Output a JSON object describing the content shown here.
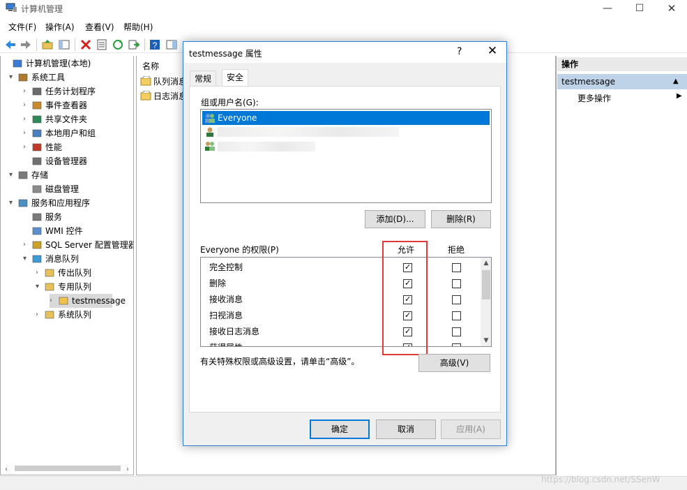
{
  "window": {
    "title": "计算机管理",
    "min_glyph": "—",
    "max_glyph": "☐",
    "close_glyph": "✕"
  },
  "menu": [
    {
      "label": "文件(F)"
    },
    {
      "label": "操作(A)"
    },
    {
      "label": "查看(V)"
    },
    {
      "label": "帮助(H)"
    }
  ],
  "tree": {
    "items": [
      {
        "label": "计算机管理(本地)",
        "expander": "",
        "icon": "computer-icon"
      },
      {
        "label": "系统工具",
        "expander": "▾",
        "icon": "tools-icon"
      },
      {
        "label": "任务计划程序",
        "expander": "›",
        "icon": "clock-icon"
      },
      {
        "label": "事件查看器",
        "expander": "›",
        "icon": "event-viewer-icon"
      },
      {
        "label": "共享文件夹",
        "expander": "›",
        "icon": "shared-folder-icon"
      },
      {
        "label": "本地用户和组",
        "expander": "›",
        "icon": "users-icon"
      },
      {
        "label": "性能",
        "expander": "›",
        "icon": "performance-icon"
      },
      {
        "label": "设备管理器",
        "expander": "",
        "icon": "device-manager-icon"
      },
      {
        "label": "存储",
        "expander": "▾",
        "icon": "storage-icon"
      },
      {
        "label": "磁盘管理",
        "expander": "",
        "icon": "disk-icon"
      },
      {
        "label": "服务和应用程序",
        "expander": "▾",
        "icon": "services-apps-icon"
      },
      {
        "label": "服务",
        "expander": "",
        "icon": "gear-icon"
      },
      {
        "label": "WMI 控件",
        "expander": "",
        "icon": "wmi-icon"
      },
      {
        "label": "SQL Server 配置管理器",
        "expander": "›",
        "icon": "sql-server-icon"
      },
      {
        "label": "消息队列",
        "expander": "▾",
        "icon": "message-queue-icon"
      },
      {
        "label": "传出队列",
        "expander": "›",
        "icon": "folder-icon"
      },
      {
        "label": "专用队列",
        "expander": "▾",
        "icon": "folder-icon"
      },
      {
        "label": "testmessage",
        "expander": "›",
        "icon": "queue-folder-icon"
      },
      {
        "label": "系统队列",
        "expander": "›",
        "icon": "folder-icon"
      }
    ]
  },
  "list": {
    "column_name": "名称",
    "rows": [
      {
        "label": "队列消息"
      },
      {
        "label": "日志消息"
      }
    ]
  },
  "actions": {
    "header": "操作",
    "section": "testmessage",
    "more": "更多操作",
    "collapse_glyph": "▲",
    "more_arrow": "▶"
  },
  "dialog": {
    "title": "testmessage 属性",
    "help": "?",
    "close": "✕",
    "tabs": [
      {
        "label": "常规",
        "active": false
      },
      {
        "label": "安全",
        "active": true
      }
    ],
    "group_label": "组或用户名(G):",
    "users": [
      {
        "name": "Everyone",
        "selected": true
      },
      {
        "name": "",
        "selected": false
      },
      {
        "name": "",
        "selected": false
      }
    ],
    "add_button": "添加(D)...",
    "remove_button": "删除(R)",
    "perm_label": "Everyone 的权限(P)",
    "allow_header": "允许",
    "deny_header": "拒绝",
    "permissions": [
      {
        "name": "完全控制",
        "allow": true,
        "deny": false
      },
      {
        "name": "删除",
        "allow": true,
        "deny": false
      },
      {
        "name": "接收消息",
        "allow": true,
        "deny": false
      },
      {
        "name": "扫视消息",
        "allow": true,
        "deny": false
      },
      {
        "name": "接收日志消息",
        "allow": true,
        "deny": false
      },
      {
        "name": "获得属性",
        "allow": true,
        "deny": false
      }
    ],
    "advanced_text": "有关特殊权限或高级设置，请单击“高级”。",
    "advanced_button": "高级(V)",
    "ok_button": "确定",
    "cancel_button": "取消",
    "apply_button": "应用(A)"
  },
  "watermark": "https://blog.csdn.net/SSenW",
  "colors": {
    "selection": "#0078d7",
    "highlight_box": "#e23a3a",
    "action_section_bg": "#bfd3e8"
  }
}
